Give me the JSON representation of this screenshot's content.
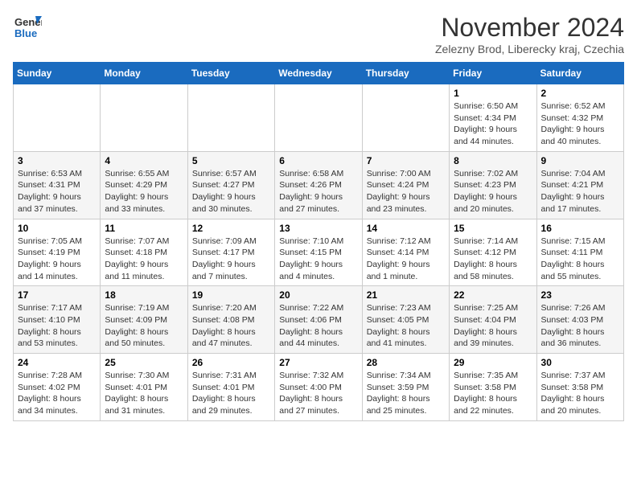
{
  "header": {
    "logo_line1": "General",
    "logo_line2": "Blue",
    "month_title": "November 2024",
    "location": "Zelezny Brod, Liberecky kraj, Czechia"
  },
  "weekdays": [
    "Sunday",
    "Monday",
    "Tuesday",
    "Wednesday",
    "Thursday",
    "Friday",
    "Saturday"
  ],
  "weeks": [
    [
      {
        "day": "",
        "info": ""
      },
      {
        "day": "",
        "info": ""
      },
      {
        "day": "",
        "info": ""
      },
      {
        "day": "",
        "info": ""
      },
      {
        "day": "",
        "info": ""
      },
      {
        "day": "1",
        "info": "Sunrise: 6:50 AM\nSunset: 4:34 PM\nDaylight: 9 hours\nand 44 minutes."
      },
      {
        "day": "2",
        "info": "Sunrise: 6:52 AM\nSunset: 4:32 PM\nDaylight: 9 hours\nand 40 minutes."
      }
    ],
    [
      {
        "day": "3",
        "info": "Sunrise: 6:53 AM\nSunset: 4:31 PM\nDaylight: 9 hours\nand 37 minutes."
      },
      {
        "day": "4",
        "info": "Sunrise: 6:55 AM\nSunset: 4:29 PM\nDaylight: 9 hours\nand 33 minutes."
      },
      {
        "day": "5",
        "info": "Sunrise: 6:57 AM\nSunset: 4:27 PM\nDaylight: 9 hours\nand 30 minutes."
      },
      {
        "day": "6",
        "info": "Sunrise: 6:58 AM\nSunset: 4:26 PM\nDaylight: 9 hours\nand 27 minutes."
      },
      {
        "day": "7",
        "info": "Sunrise: 7:00 AM\nSunset: 4:24 PM\nDaylight: 9 hours\nand 23 minutes."
      },
      {
        "day": "8",
        "info": "Sunrise: 7:02 AM\nSunset: 4:23 PM\nDaylight: 9 hours\nand 20 minutes."
      },
      {
        "day": "9",
        "info": "Sunrise: 7:04 AM\nSunset: 4:21 PM\nDaylight: 9 hours\nand 17 minutes."
      }
    ],
    [
      {
        "day": "10",
        "info": "Sunrise: 7:05 AM\nSunset: 4:19 PM\nDaylight: 9 hours\nand 14 minutes."
      },
      {
        "day": "11",
        "info": "Sunrise: 7:07 AM\nSunset: 4:18 PM\nDaylight: 9 hours\nand 11 minutes."
      },
      {
        "day": "12",
        "info": "Sunrise: 7:09 AM\nSunset: 4:17 PM\nDaylight: 9 hours\nand 7 minutes."
      },
      {
        "day": "13",
        "info": "Sunrise: 7:10 AM\nSunset: 4:15 PM\nDaylight: 9 hours\nand 4 minutes."
      },
      {
        "day": "14",
        "info": "Sunrise: 7:12 AM\nSunset: 4:14 PM\nDaylight: 9 hours\nand 1 minute."
      },
      {
        "day": "15",
        "info": "Sunrise: 7:14 AM\nSunset: 4:12 PM\nDaylight: 8 hours\nand 58 minutes."
      },
      {
        "day": "16",
        "info": "Sunrise: 7:15 AM\nSunset: 4:11 PM\nDaylight: 8 hours\nand 55 minutes."
      }
    ],
    [
      {
        "day": "17",
        "info": "Sunrise: 7:17 AM\nSunset: 4:10 PM\nDaylight: 8 hours\nand 53 minutes."
      },
      {
        "day": "18",
        "info": "Sunrise: 7:19 AM\nSunset: 4:09 PM\nDaylight: 8 hours\nand 50 minutes."
      },
      {
        "day": "19",
        "info": "Sunrise: 7:20 AM\nSunset: 4:08 PM\nDaylight: 8 hours\nand 47 minutes."
      },
      {
        "day": "20",
        "info": "Sunrise: 7:22 AM\nSunset: 4:06 PM\nDaylight: 8 hours\nand 44 minutes."
      },
      {
        "day": "21",
        "info": "Sunrise: 7:23 AM\nSunset: 4:05 PM\nDaylight: 8 hours\nand 41 minutes."
      },
      {
        "day": "22",
        "info": "Sunrise: 7:25 AM\nSunset: 4:04 PM\nDaylight: 8 hours\nand 39 minutes."
      },
      {
        "day": "23",
        "info": "Sunrise: 7:26 AM\nSunset: 4:03 PM\nDaylight: 8 hours\nand 36 minutes."
      }
    ],
    [
      {
        "day": "24",
        "info": "Sunrise: 7:28 AM\nSunset: 4:02 PM\nDaylight: 8 hours\nand 34 minutes."
      },
      {
        "day": "25",
        "info": "Sunrise: 7:30 AM\nSunset: 4:01 PM\nDaylight: 8 hours\nand 31 minutes."
      },
      {
        "day": "26",
        "info": "Sunrise: 7:31 AM\nSunset: 4:01 PM\nDaylight: 8 hours\nand 29 minutes."
      },
      {
        "day": "27",
        "info": "Sunrise: 7:32 AM\nSunset: 4:00 PM\nDaylight: 8 hours\nand 27 minutes."
      },
      {
        "day": "28",
        "info": "Sunrise: 7:34 AM\nSunset: 3:59 PM\nDaylight: 8 hours\nand 25 minutes."
      },
      {
        "day": "29",
        "info": "Sunrise: 7:35 AM\nSunset: 3:58 PM\nDaylight: 8 hours\nand 22 minutes."
      },
      {
        "day": "30",
        "info": "Sunrise: 7:37 AM\nSunset: 3:58 PM\nDaylight: 8 hours\nand 20 minutes."
      }
    ]
  ]
}
